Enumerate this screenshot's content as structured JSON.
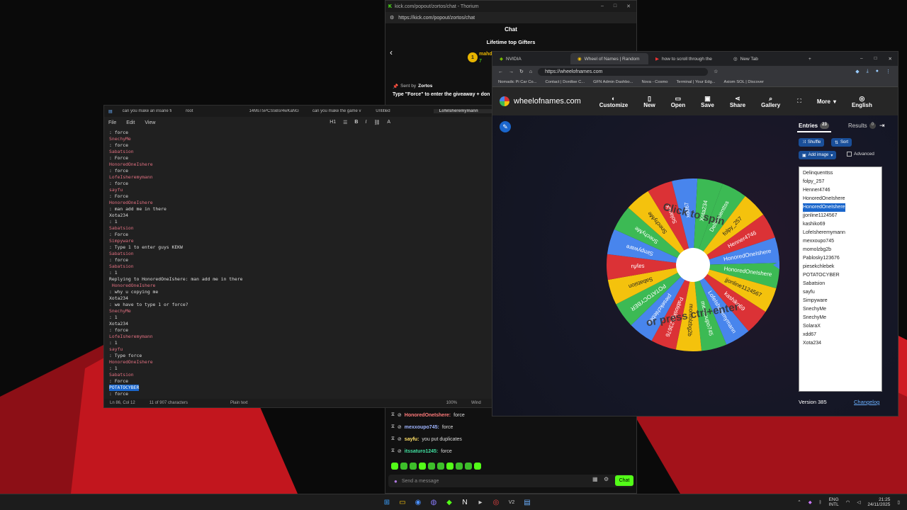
{
  "kick": {
    "title": "kick.com/popout/zortos/chat - Thorium",
    "url": "https://kick.com/popout/zortos/chat",
    "heading": "Chat",
    "subheading": "Lifetime top Gifters",
    "gifter_name": "mahd",
    "gifter_count": "7",
    "sent_by_label": "Sent by",
    "sent_by_user": "Zortos",
    "pinned": "Type \"Force\" to enter the giveaway + don",
    "messages": [
      {
        "user": "HonoredOneIshere:",
        "text": "force",
        "color": "#ff7a7a"
      },
      {
        "user": "mexxoupo745:",
        "text": "force",
        "color": "#9fb5ff"
      },
      {
        "user": "sayfu:",
        "text": "you put duplicates",
        "color": "#ffe066"
      },
      {
        "user": "itssaturo1245:",
        "text": "force",
        "color": "#40e0a0"
      }
    ],
    "send_placeholder": "Send a message",
    "chat_button": "Chat"
  },
  "notes": {
    "tabs": [
      "can you make an insane fi",
      "root",
      "14MsT5PCS5Bsr4wKaNG",
      "can you make the game v",
      "Untitled",
      "LofeIsheremymann"
    ],
    "menu": [
      "File",
      "Edit",
      "View"
    ],
    "toolbar": {
      "heading": "H1"
    },
    "lines": [
      {
        "t": ": force",
        "u": false
      },
      {
        "t": "SnechyMe",
        "u": true
      },
      {
        "t": ": force",
        "u": false
      },
      {
        "t": "Sabatsion",
        "u": true
      },
      {
        "t": ": Force",
        "u": false
      },
      {
        "t": "HonoredOneIshere",
        "u": true
      },
      {
        "t": ": force",
        "u": false
      },
      {
        "t": "LofeIsheremymann",
        "u": true
      },
      {
        "t": ": force",
        "u": false
      },
      {
        "t": "sayfu",
        "u": true
      },
      {
        "t": ": Force",
        "u": false
      },
      {
        "t": "HonoredOneIshere",
        "u": true
      },
      {
        "t": ": man add me in there",
        "u": false
      },
      {
        "t": "Xota234",
        "u": false
      },
      {
        "t": ": 1",
        "u": false
      },
      {
        "t": "Sabatsion",
        "u": true
      },
      {
        "t": ": Force",
        "u": false
      },
      {
        "t": "Simpyware",
        "u": true
      },
      {
        "t": ": Type 1 to enter guys KEKW",
        "u": false
      },
      {
        "t": "Sabatsion",
        "u": true
      },
      {
        "t": ": force",
        "u": false
      },
      {
        "t": "Sabatsion",
        "u": true
      },
      {
        "t": ": 1",
        "u": false
      },
      {
        "t": "Replying to HonoredOneIshere: man add me in there",
        "u": false
      },
      {
        "t": " HonoredOneIshere",
        "u": true
      },
      {
        "t": ": why u copying me",
        "u": false
      },
      {
        "t": "Xota234",
        "u": false
      },
      {
        "t": ": we have to type 1 or force?",
        "u": false
      },
      {
        "t": "SnechyMe",
        "u": true
      },
      {
        "t": ": 1",
        "u": false
      },
      {
        "t": "Xota234",
        "u": false
      },
      {
        "t": ": force",
        "u": false
      },
      {
        "t": "LofeIsheremymann",
        "u": true
      },
      {
        "t": ": 1",
        "u": false
      },
      {
        "t": "sayfu",
        "u": true
      },
      {
        "t": ": Type force",
        "u": false
      },
      {
        "t": "HonoredOneIshere",
        "u": true
      },
      {
        "t": ": 1",
        "u": false
      },
      {
        "t": "Sabatsion",
        "u": true
      },
      {
        "t": ": Force",
        "u": false
      },
      {
        "t": "POTATOCYBER",
        "u": true
      },
      {
        "t": ": force",
        "u": false
      }
    ],
    "status": {
      "position": "Ln 86, Col 12",
      "chars": "11 of 907 characters",
      "format": "Plain text",
      "zoom": "100%",
      "encoding": "Wind"
    }
  },
  "won": {
    "tabs": [
      "NVIDIA",
      "Wheel of Names | Random",
      "how to scroll through the",
      "New Tab"
    ],
    "url": "https://wheelofnames.com",
    "bookmarks": [
      "Nomadic Pi Car Co...",
      "Contact | Dordtse C...",
      "GFN Admin Dashbo...",
      "Nova - Cosmo",
      "Terminal | Your Edg...",
      "Axiom SOL | Discover"
    ],
    "site": "wheelofnames.com",
    "header_buttons": [
      "Customize",
      "New",
      "Open",
      "Save",
      "Share",
      "Gallery",
      "More",
      "English"
    ],
    "wheel_text_top": "Click to spin",
    "wheel_text_bottom": "or press ctrl+enter",
    "tab_entries": "Entries",
    "entries_count": "23",
    "tab_results": "Results",
    "results_count": "0",
    "shuffle": "Shuffle",
    "sort": "Sort",
    "add_image": "Add image",
    "advanced": "Advanced",
    "entries": [
      "Delinquenttss",
      "folpy_257",
      "Henner4746",
      "HonoredOneIshere",
      "HonoredOneIshere",
      "jjonline1124567",
      "kashiko69",
      "LofeIsheremymann",
      "mexxoupo745",
      "momolzbg2b",
      "Pablosky123676",
      "piesekchlebek",
      "POTATOCYBER",
      "Sabatsion",
      "sayfu",
      "Simpyware",
      "SnechyMe",
      "SnechyMe",
      "SolaraX",
      "xdd67",
      "Xota234"
    ],
    "version": "Version 385",
    "changelog": "Changelog"
  },
  "taskbar": {
    "lang": "ENG",
    "lang2": "INTL",
    "time": "21:25",
    "date": "24/11/2025"
  },
  "colors": {
    "wheel_red": "#db3236",
    "wheel_yellow": "#f4c20d",
    "wheel_green": "#3cba54",
    "wheel_blue": "#4885ed",
    "kick_green": "#53fc18"
  }
}
